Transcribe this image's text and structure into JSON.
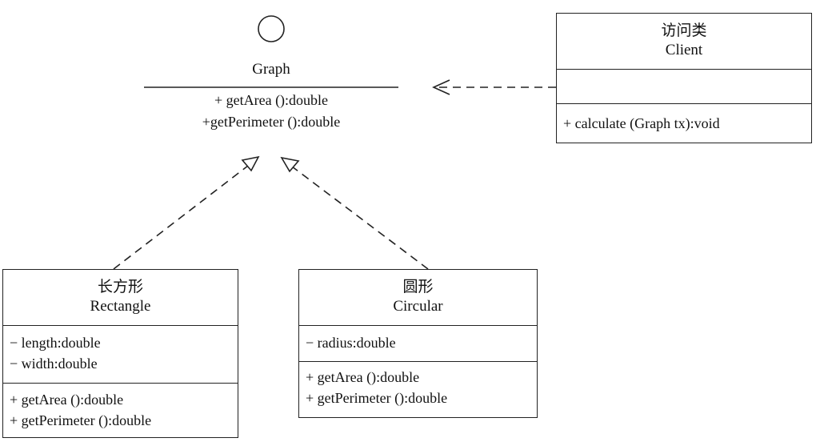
{
  "interface": {
    "name": "Graph",
    "methods": [
      "+ getArea ():double",
      "+getPerimeter ():double"
    ]
  },
  "client": {
    "name_cn": "访问类",
    "name": "Client",
    "attributes": [],
    "methods": [
      "+ calculate (Graph tx):void"
    ]
  },
  "rectangle": {
    "name_cn": "长方形",
    "name": "Rectangle",
    "attributes": [
      "− length:double",
      "− width:double"
    ],
    "methods": [
      "+ getArea ():double",
      "+ getPerimeter ():double"
    ]
  },
  "circular": {
    "name_cn": "圆形",
    "name": "Circular",
    "attributes": [
      "− radius:double"
    ],
    "methods": [
      "+ getArea ():double",
      "+ getPerimeter ():double"
    ]
  }
}
